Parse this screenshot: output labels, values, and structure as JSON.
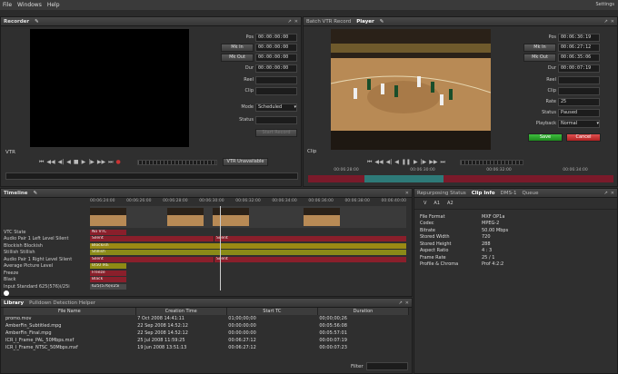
{
  "menu": [
    "File",
    "Windows",
    "Help"
  ],
  "window_title": "Settings",
  "recorder": {
    "title": "Recorder",
    "fields": [
      {
        "label": "Pos",
        "value": "00:00:00:00"
      },
      {
        "label": "Mk In",
        "value": "00:00:00:00"
      },
      {
        "label": "Mk Out",
        "value": "00:00:00:00"
      },
      {
        "label": "Dur",
        "value": "00:00:00:00"
      },
      {
        "label": "Reel",
        "value": ""
      },
      {
        "label": "Clip",
        "value": ""
      }
    ],
    "mode_label": "Mode",
    "mode_value": "Scheduled",
    "status_label": "Status",
    "status_value": "",
    "start_record": "Start Record",
    "vtr_label": "VTR",
    "vtr_status": "VTR Unavailable"
  },
  "player": {
    "tabs": [
      "Batch VTR Record",
      "Player"
    ],
    "clip_label": "Clip",
    "fields": [
      {
        "label": "Pos",
        "value": "00:06:30:19"
      },
      {
        "label": "Mk In",
        "value": "00:06:27:12"
      },
      {
        "label": "Mk Out",
        "value": "00:06:35:06"
      },
      {
        "label": "Dur",
        "value": "00:00:07:19"
      }
    ],
    "reel_label": "Reel",
    "clip_field_label": "Clip",
    "rate_label": "Rate",
    "rate_value": "25",
    "status_label": "Status",
    "status_value": "Paused",
    "playback_label": "Playback",
    "playback_value": "Normal",
    "save": "Save",
    "cancel": "Cancel",
    "ruler": [
      "00:06:28:00",
      "00:06:30:00",
      "00:06:32:00",
      "00:06:34:00"
    ]
  },
  "timeline": {
    "title": "Timeline",
    "ruler": [
      "00:06:24:00",
      "00:06:26:00",
      "00:06:28:00",
      "00:06:30:00",
      "00:06:32:00",
      "00:06:34:00",
      "00:06:36:00",
      "00:06:38:00",
      "00:06:40:00"
    ],
    "tracks": [
      {
        "label": "VTC State",
        "bar": "No VTC",
        "color": "#8a1f2b"
      },
      {
        "label": "Audio Pair 1 Left Level  Silent",
        "bar": "Silent",
        "bar2": "Silent",
        "color": "#8a1f2b"
      },
      {
        "label": "Blockish  Blockish",
        "bar": "Blockish",
        "color": "#9a8a14"
      },
      {
        "label": "Stillish  Stillish",
        "bar": "Stillish",
        "color": "#8a8a18"
      },
      {
        "label": "Audio Pair 1 Right Level  Silent",
        "bar": "Silent",
        "bar2": "Silent",
        "color": "#8a1f2b"
      },
      {
        "label": "Average Picture Level",
        "bar": "0/50 IRE",
        "color": "#8f8a14"
      },
      {
        "label": "Freeze",
        "bar": "Freeze",
        "color": "#8a1f2b"
      },
      {
        "label": "Black",
        "bar": "Black",
        "color": "#8a1f2b"
      },
      {
        "label": "Input Standard  625(576)i/25i",
        "bar": "625(576)i/25i",
        "color": "#4a4a4a"
      }
    ]
  },
  "clipinfo": {
    "tabs": [
      "Repurposing Status",
      "Clip Info",
      "DMS-1",
      "Queue"
    ],
    "subtabs": [
      "V",
      "A1",
      "A2"
    ],
    "rows": [
      {
        "k": "File Format",
        "v": "MXF OP1a"
      },
      {
        "k": "Codec",
        "v": "MPEG-2"
      },
      {
        "k": "Bitrate",
        "v": "50.00 Mbps"
      },
      {
        "k": "Stored Width",
        "v": "720"
      },
      {
        "k": "Stored Height",
        "v": "288"
      },
      {
        "k": "Aspect Ratio",
        "v": "4 : 3"
      },
      {
        "k": "Frame Rate",
        "v": "25 / 1"
      },
      {
        "k": "Profile & Chroma",
        "v": "Prof 4:2:2"
      }
    ]
  },
  "library": {
    "tabs": [
      "Library",
      "Pulldown Detection Helper"
    ],
    "headers": [
      "File Name",
      "Creation Time",
      "Start TC",
      "Duration"
    ],
    "rows": [
      [
        "promo.mov",
        "7 Oct 2008 14:41:11",
        "01;00;00;00",
        "00;00;00;26"
      ],
      [
        "AmberFin_Subtitled.mpg",
        "22 Sep 2008 14:52:12",
        "00:00:00:00",
        "00:05:56:08"
      ],
      [
        "AmberFin_Final.mpg",
        "22 Sep 2008 14:52:12",
        "00:00:00:00",
        "00:05:57:01"
      ],
      [
        "ICR_I_Frame_PAL_50Mbps.mxf",
        "25 Jul 2008 11:59:25",
        "00:06:27:12",
        "00:00:07:19"
      ],
      [
        "ICR_I_Frame_NTSC_50Mbps.mxf",
        "19 Jun 2008 13:51:13",
        "00:06:27:12",
        "00:00:07:23"
      ]
    ],
    "filter_label": "Filter"
  }
}
